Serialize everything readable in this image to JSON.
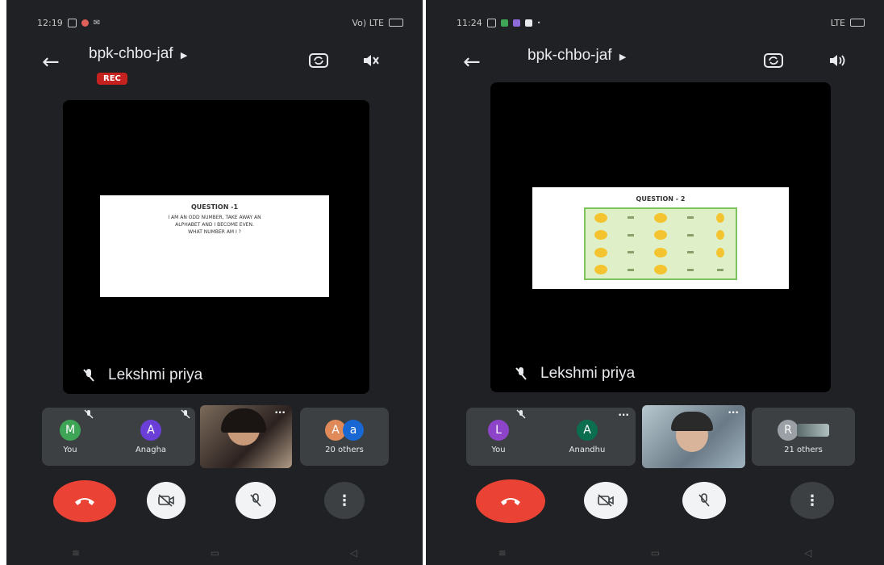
{
  "left": {
    "status": {
      "time": "12:19",
      "signal": "Vo) LTE",
      "battery": "59"
    },
    "meeting_code": "bpk-chbo-jaf",
    "rec_label": "REC",
    "slide": {
      "heading": "QUESTION -1",
      "lines": [
        "I AM AN ODD NUMBER, TAKE AWAY AN",
        "ALPHABET AND I BECOME EVEN.",
        "WHAT NUMBER AM I ?"
      ]
    },
    "speaker_name": "Lekshmi priya",
    "participants": [
      {
        "initial": "M",
        "label": "You",
        "color": "#3ea556"
      },
      {
        "initial": "A",
        "label": "Anagha",
        "color": "#6a3fd8"
      },
      {
        "initial": "A",
        "label": "20 others",
        "color": "#e08a5a",
        "initial2": "a",
        "color2": "#1967d2"
      }
    ],
    "controls": [
      "end-call",
      "camera-off",
      "mic-off",
      "more"
    ],
    "colors": {
      "end": "#ea4335",
      "light": "#f1f3f4",
      "dark": "#3c4043"
    }
  },
  "right": {
    "status": {
      "time": "11:24",
      "signal": "LTE",
      "battery": ""
    },
    "meeting_code": "bpk-chbo-jaf",
    "slide": {
      "heading": "QUESTION - 2"
    },
    "speaker_name": "Lekshmi priya",
    "participants": [
      {
        "initial": "L",
        "label": "You",
        "color": "#8e44c9"
      },
      {
        "initial": "A",
        "label": "Anandhu",
        "color": "#0b6e4f"
      },
      {
        "initial": "R",
        "label": "21 others",
        "color": "#9aa0a6"
      }
    ],
    "controls": [
      "end-call",
      "camera-off",
      "mic-off",
      "more"
    ]
  }
}
